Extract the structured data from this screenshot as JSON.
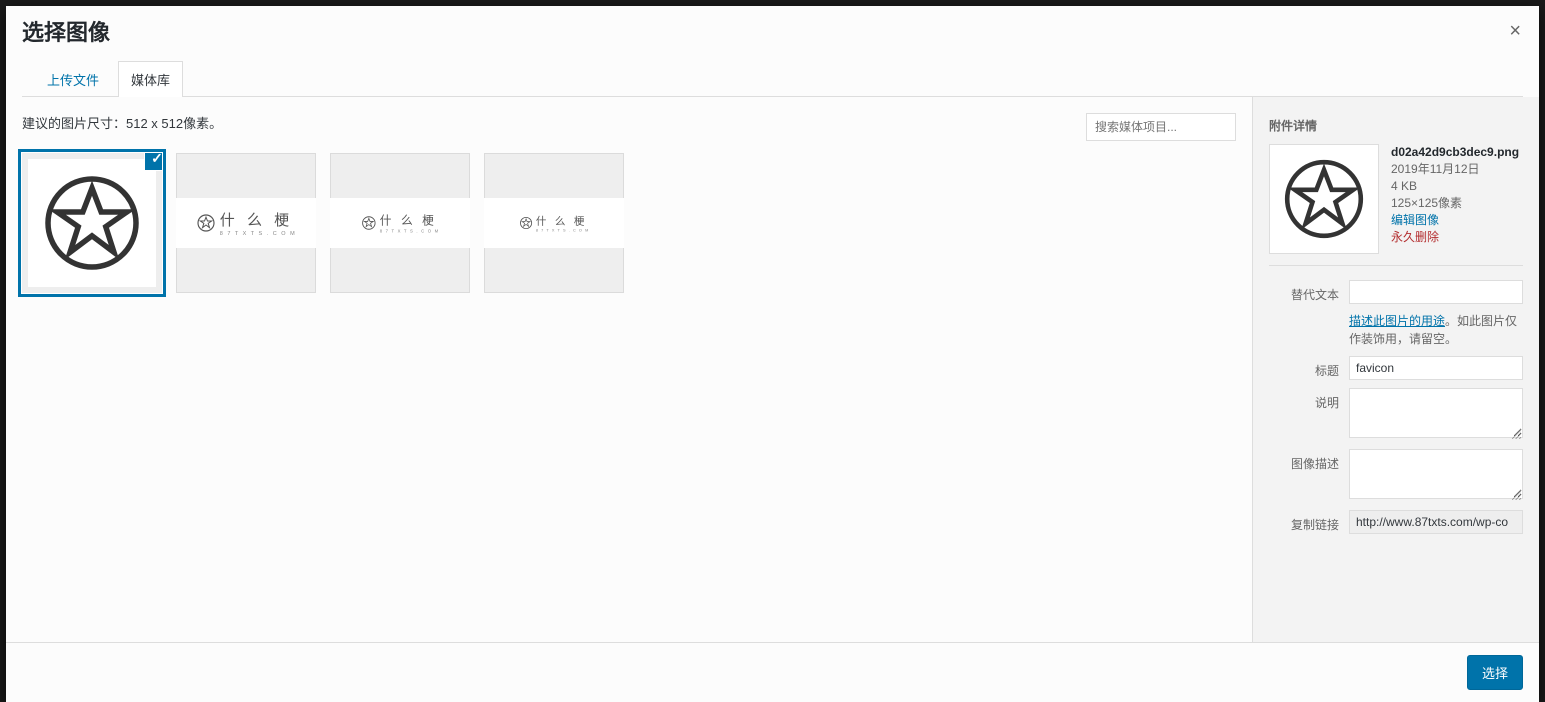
{
  "header": {
    "title": "选择图像",
    "close": "×"
  },
  "tabs": {
    "upload": "上传文件",
    "library": "媒体库"
  },
  "main": {
    "hint": "建议的图片尺寸：512 x 512像素。",
    "search_placeholder": "搜索媒体项目..."
  },
  "thumbs": {
    "logo_cn": "什 么 梗",
    "logo_sub": "8 7 T X T S . C O M"
  },
  "sidebar": {
    "heading": "附件详情",
    "filename": "d02a42d9cb3dec9.png",
    "date": "2019年11月12日",
    "size": "4 KB",
    "dimensions": "125×125像素",
    "edit": "编辑图像",
    "delete": "永久删除",
    "fields": {
      "alt_label": "替代文本",
      "alt_value": "",
      "alt_help_link": "描述此图片的用途",
      "alt_help_rest": "。如此图片仅作装饰用，请留空。",
      "title_label": "标题",
      "title_value": "favicon",
      "caption_label": "说明",
      "caption_value": "",
      "desc_label": "图像描述",
      "desc_value": "",
      "url_label": "复制链接",
      "url_value": "http://www.87txts.com/wp-co"
    }
  },
  "footer": {
    "select": "选择"
  }
}
